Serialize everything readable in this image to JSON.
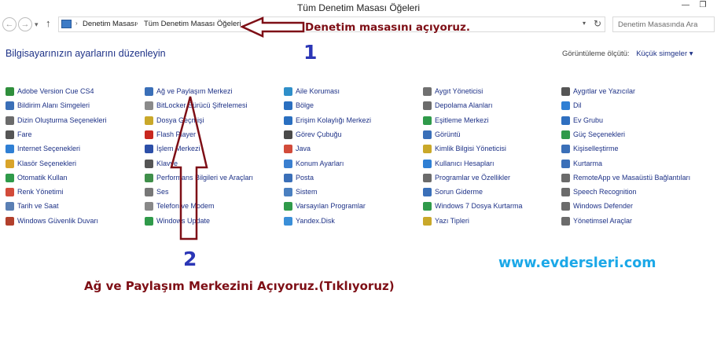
{
  "window": {
    "title": "Tüm Denetim Masası Öğeleri",
    "minimize_glyph": "—",
    "restore_glyph": "❐"
  },
  "nav": {
    "back_glyph": "←",
    "forward_glyph": "→",
    "history_glyph": "▾",
    "up_glyph": "↑"
  },
  "address": {
    "breadcrumbs": [
      "Denetim Masası",
      "Tüm Denetim Masası Öğeleri"
    ],
    "separator_glyph": "›",
    "dropdown_glyph": "▾",
    "refresh_glyph": "↻"
  },
  "search": {
    "placeholder": "Denetim Masasında Ara"
  },
  "header": {
    "title": "Bilgisayarınızın ayarlarını düzenleyin",
    "view_by_label": "Görüntüleme ölçütü:",
    "view_by_value": "Küçük simgeler ▾"
  },
  "columns": [
    [
      "Adobe Version Cue CS4",
      "Bildirim Alanı Simgeleri",
      "Dizin Oluşturma Seçenekleri",
      "Fare",
      "Internet Seçenekleri",
      "Klasör Seçenekleri",
      "Otomatik Kullan",
      "Renk Yönetimi",
      "Tarih ve Saat",
      "Windows Güvenlik Duvarı"
    ],
    [
      "Ağ ve Paylaşım Merkezi",
      "BitLocker Sürücü Şifrelemesi",
      "Dosya Geçmişi",
      "Flash Player",
      "İşlem Merkezi",
      "Klavye",
      "Performans Bilgileri ve Araçları",
      "Ses",
      "Telefon ve Modem",
      "Windows Update"
    ],
    [
      "Aile Koruması",
      "Bölge",
      "Erişim Kolaylığı Merkezi",
      "Görev Çubuğu",
      "Java",
      "Konum Ayarları",
      "Posta",
      "Sistem",
      "Varsayılan Programlar",
      "Yandex.Disk"
    ],
    [
      "Aygıt Yöneticisi",
      "Depolama Alanları",
      "Eşitleme Merkezi",
      "Görüntü",
      "Kimlik Bilgisi Yöneticisi",
      "Kullanıcı Hesapları",
      "Programlar ve Özellikler",
      "Sorun Giderme",
      "Windows 7 Dosya Kurtarma",
      "Yazı Tipleri"
    ],
    [
      "Aygıtlar ve Yazıcılar",
      "Dil",
      "Ev Grubu",
      "Güç Seçenekleri",
      "Kişiselleştirme",
      "Kurtarma",
      "RemoteApp ve Masaüstü Bağlantıları",
      "Speech Recognition",
      "Windows Defender",
      "Yönetimsel Araçlar"
    ]
  ],
  "icon_colors": [
    [
      "#2f8f3c",
      "#3a6fb8",
      "#6b6b6b",
      "#555555",
      "#2f7fd4",
      "#d9a42a",
      "#2f9a4a",
      "#d24b3a",
      "#5a7fb4",
      "#b2402c"
    ],
    [
      "#3a6fb8",
      "#8a8a8a",
      "#c9a82a",
      "#c8271f",
      "#2c4fa8",
      "#555555",
      "#3f8f4a",
      "#777777",
      "#888888",
      "#2f9a4a"
    ],
    [
      "#2f8fc9",
      "#2a6fc0",
      "#2a6fc0",
      "#4a4a4a",
      "#d24b3a",
      "#3a7fd0",
      "#3a6fb8",
      "#4a7fc0",
      "#2f9a4a",
      "#3a8fd8"
    ],
    [
      "#707070",
      "#6b6b6b",
      "#2f9a4a",
      "#3a6fb8",
      "#c9a82a",
      "#2f7fd4",
      "#6b6b6b",
      "#3a6fb8",
      "#2f9a4a",
      "#c9a82a"
    ],
    [
      "#555555",
      "#2f7fd4",
      "#2f6fc0",
      "#2f9a4a",
      "#3a6fb8",
      "#3a6fb8",
      "#6b6b6b",
      "#6b6b6b",
      "#6b6b6b",
      "#6b6b6b"
    ]
  ],
  "annotations": {
    "step1_number": "1",
    "step1_text": "Denetim masasını açıyoruz.",
    "step2_number": "2",
    "step2_text": "Ağ ve Paylaşım Merkezini Açıyoruz.(Tıklıyoruz)",
    "watermark": "www.evdersleri.com",
    "arrow_color": "#7e0f16"
  }
}
